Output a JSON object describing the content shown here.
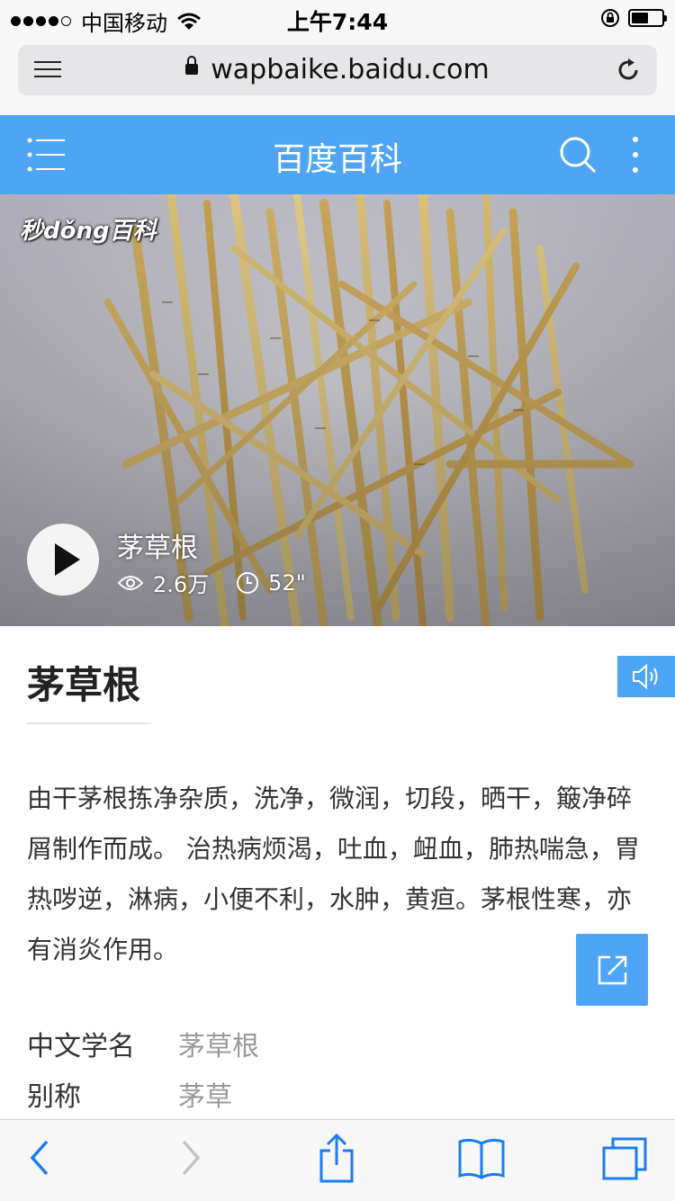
{
  "status_bar": {
    "carrier": "中国移动",
    "time": "上午7:44"
  },
  "browser": {
    "url": "wapbaike.baidu.com"
  },
  "site_header": {
    "title": "百度百科"
  },
  "video": {
    "watermark": "秒dǒng百科",
    "title": "茅草根",
    "views": "2.6万",
    "duration": "52\""
  },
  "entry": {
    "title": "茅草根",
    "summary": "由干茅根拣净杂质，洗净，微润，切段，晒干，簸净碎屑制作而成。 治热病烦渴，吐血，衄血，肺热喘急，胃热哕逆，淋病，小便不利，水肿，黄疸。茅根性寒，亦有消炎作用。",
    "info": [
      {
        "key": "中文学名",
        "value": "茅草根"
      },
      {
        "key": "别称",
        "value": "茅草"
      }
    ]
  },
  "colors": {
    "brand_blue": "#4ea5f5",
    "safari_tint": "#1a7cf5"
  }
}
